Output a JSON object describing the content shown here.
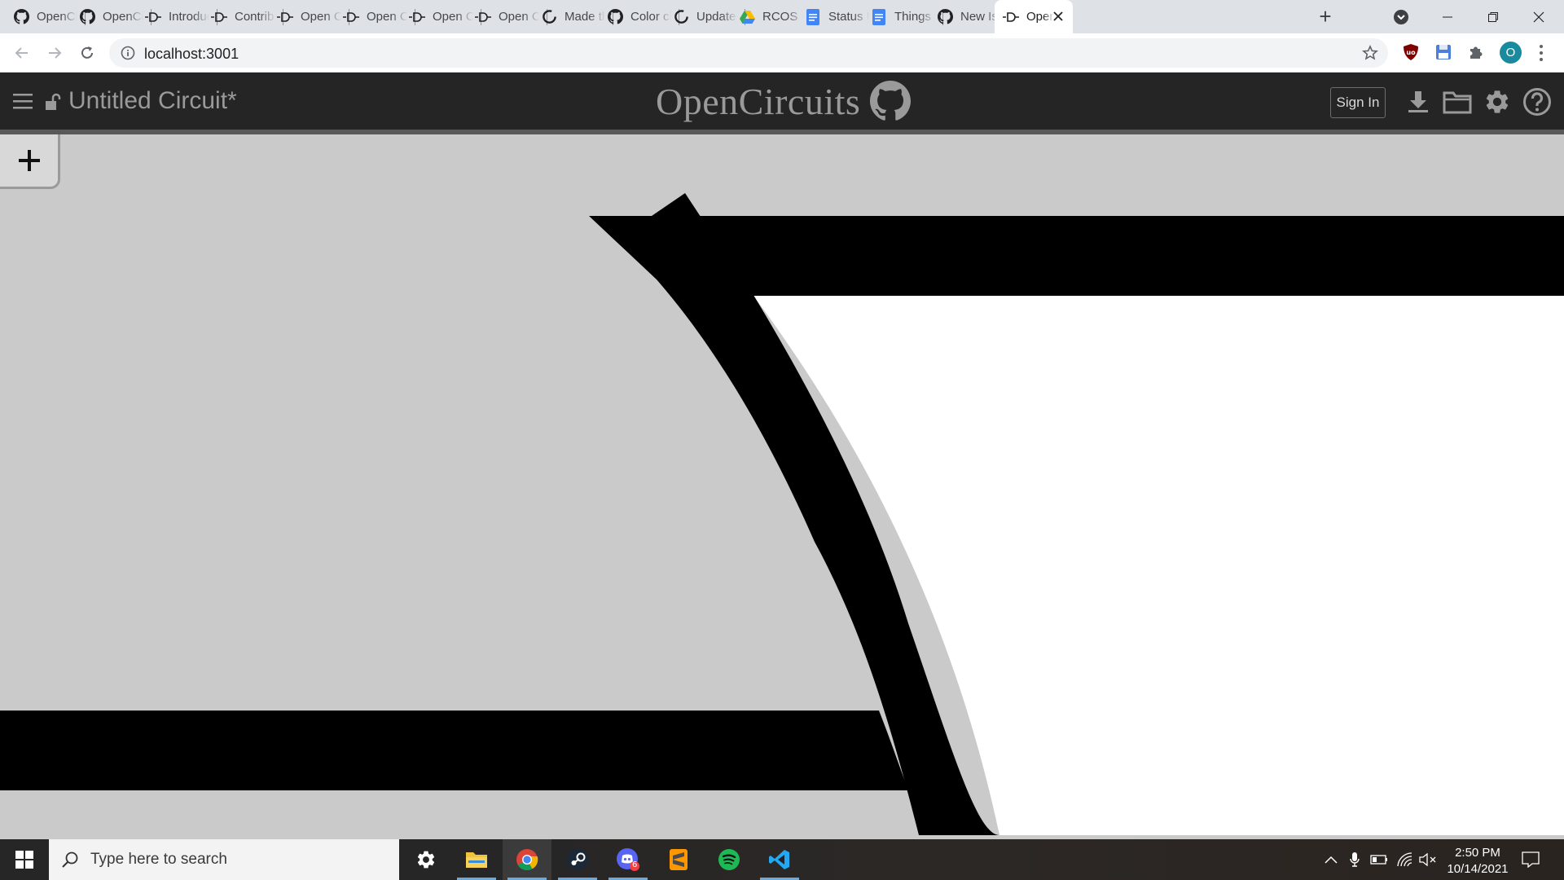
{
  "browser": {
    "tabs": [
      {
        "title": "OpenCircuits",
        "icon": "github-icon"
      },
      {
        "title": "OpenCircuits",
        "icon": "github-icon"
      },
      {
        "title": "Introduction",
        "icon": "opencircuits-icon"
      },
      {
        "title": "Contributing",
        "icon": "opencircuits-icon"
      },
      {
        "title": "Open Circuits",
        "icon": "opencircuits-icon"
      },
      {
        "title": "Open Circuits",
        "icon": "opencircuits-icon"
      },
      {
        "title": "Open Circuits",
        "icon": "opencircuits-icon"
      },
      {
        "title": "Open Circuits",
        "icon": "opencircuits-icon"
      },
      {
        "title": "Made the",
        "icon": "github-loading-icon"
      },
      {
        "title": "Color changes",
        "icon": "github-icon"
      },
      {
        "title": "Updates",
        "icon": "github-loading-icon"
      },
      {
        "title": "RCOS -",
        "icon": "google-drive-icon"
      },
      {
        "title": "Status Update",
        "icon": "google-docs-icon"
      },
      {
        "title": "Things",
        "icon": "google-docs-icon"
      },
      {
        "title": "New Issue",
        "icon": "github-icon"
      },
      {
        "title": "OpenCircuits",
        "icon": "opencircuits-icon",
        "active": true
      }
    ],
    "url": "localhost:3001",
    "profile_initial": "O"
  },
  "app": {
    "circuit_title": "Untitled Circuit*",
    "brand": "OpenCircuits",
    "sign_in_label": "Sign In",
    "add_button_label": "+"
  },
  "taskbar": {
    "search_placeholder": "Type here to search",
    "time": "2:50 PM",
    "date": "10/14/2021",
    "discord_badge": "6"
  },
  "colors": {
    "canvas_bg": "#cacaca",
    "header_bg": "#252525",
    "wire": "#000000",
    "gate_fill": "#ffffff"
  }
}
